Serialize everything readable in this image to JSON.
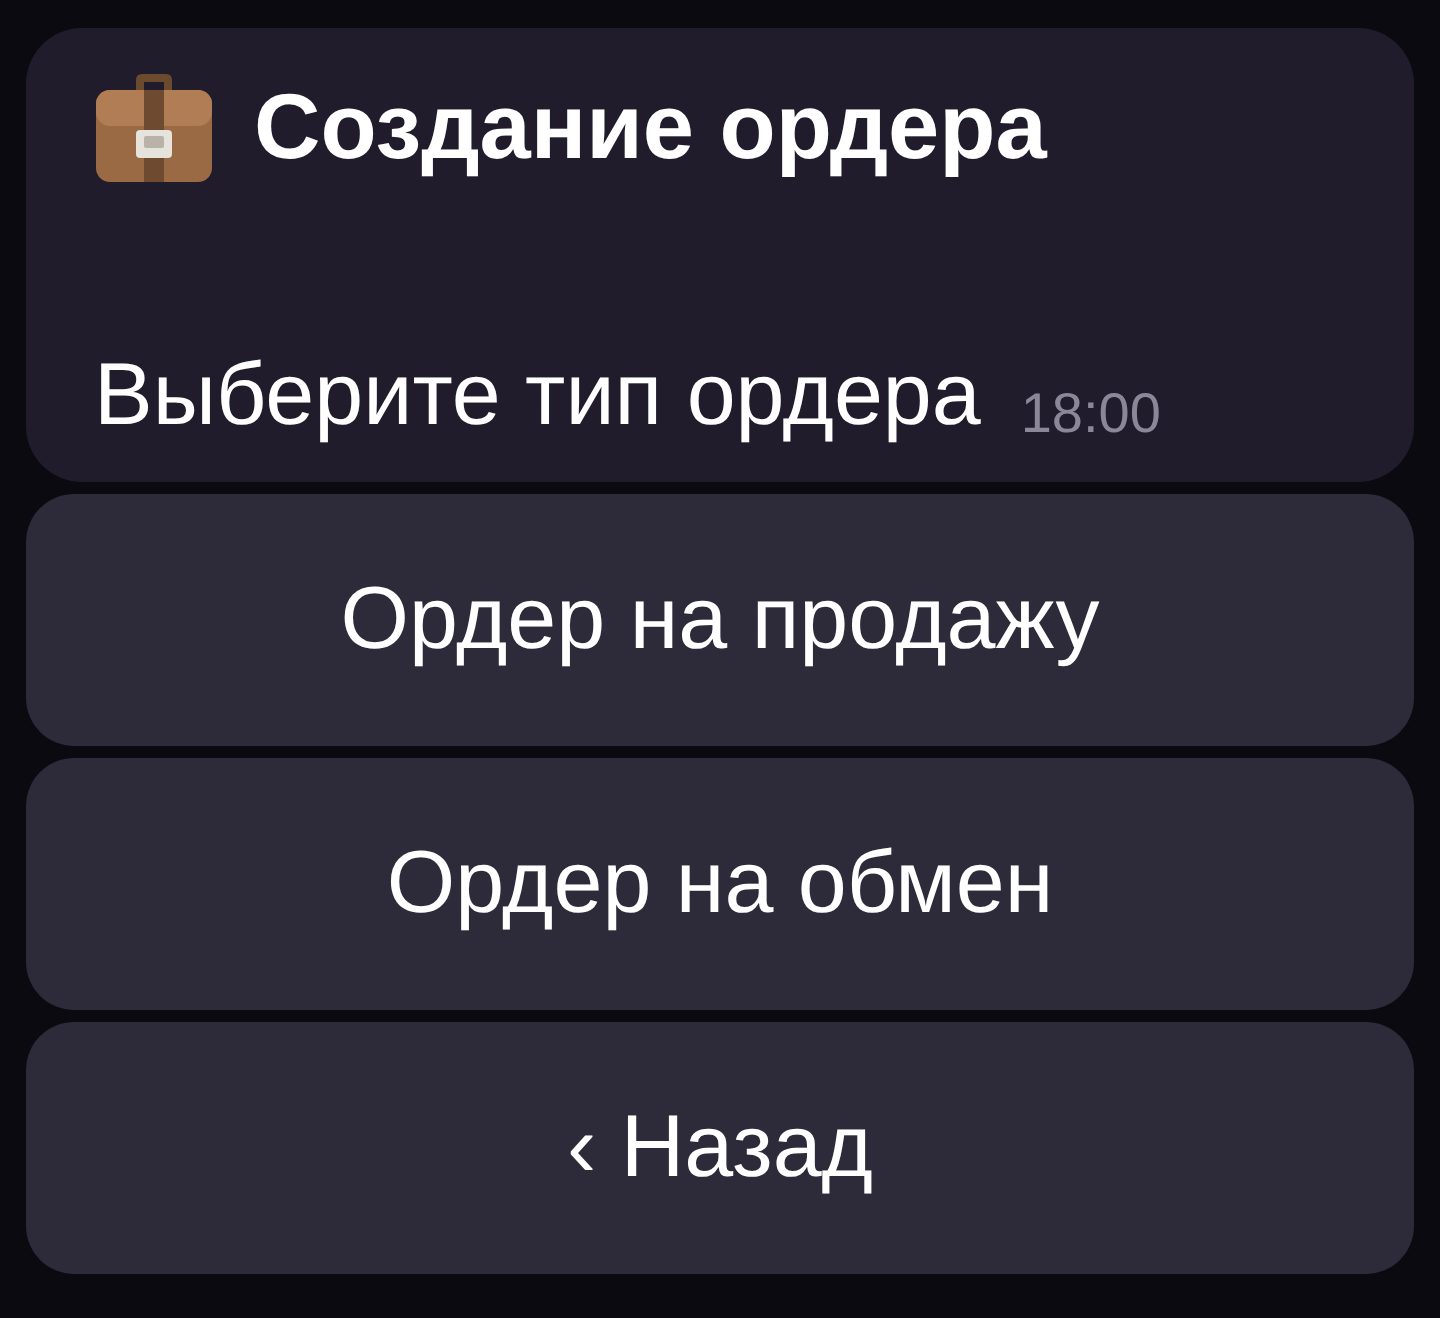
{
  "message": {
    "title": "Создание ордера",
    "text": "Выберите тип ордера",
    "time": "18:00"
  },
  "buttons": [
    {
      "label": "Ордер на продажу"
    },
    {
      "label": "Ордер на обмен"
    },
    {
      "label": "‹ Назад"
    }
  ]
}
